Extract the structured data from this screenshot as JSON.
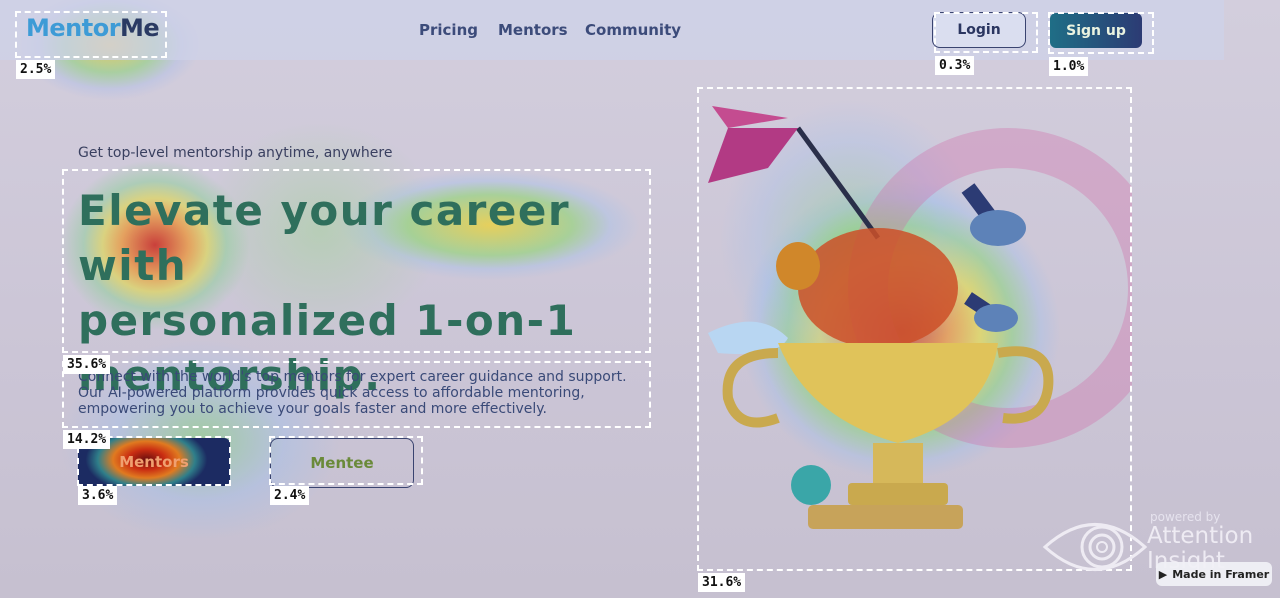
{
  "nav": {
    "logo_part1": "Mentor",
    "logo_part2": "Me",
    "links": [
      "Pricing",
      "Mentors",
      "Community"
    ],
    "login_label": "Login",
    "signup_label": "Sign up"
  },
  "hero": {
    "eyebrow": "Get top-level mentorship anytime, anywhere",
    "headline_lines": [
      "Elevate your career with",
      "personalized 1-on-1",
      "mentorship."
    ],
    "subtext_lines": [
      "Connect with the world's top mentors for expert career guidance and support.",
      "Our AI-powered platform provides quick access to affordable mentoring,",
      "empowering you to achieve your goals faster and more effectively."
    ],
    "mentors_button": "Mentors",
    "mentee_button": "Mentee"
  },
  "attention_scores": {
    "logo": "2.5%",
    "login": "0.3%",
    "signup": "1.0%",
    "headline": "35.6%",
    "subtext": "14.2%",
    "mentors_button": "3.6%",
    "mentee_button": "2.4%",
    "illustration": "31.6%"
  },
  "watermark": {
    "powered_by": "powered by",
    "brand_line1": "Attention",
    "brand_line2": "Insight",
    "framer_badge": "Made in Framer"
  },
  "colors": {
    "heat_red": "#d9261c",
    "heat_yellow": "#f2d21a",
    "heat_green": "#6fcf3c",
    "heat_blue": "#9fb8f0",
    "brand_dark": "#2c3b74",
    "headline_color": "#2f6f5c"
  }
}
